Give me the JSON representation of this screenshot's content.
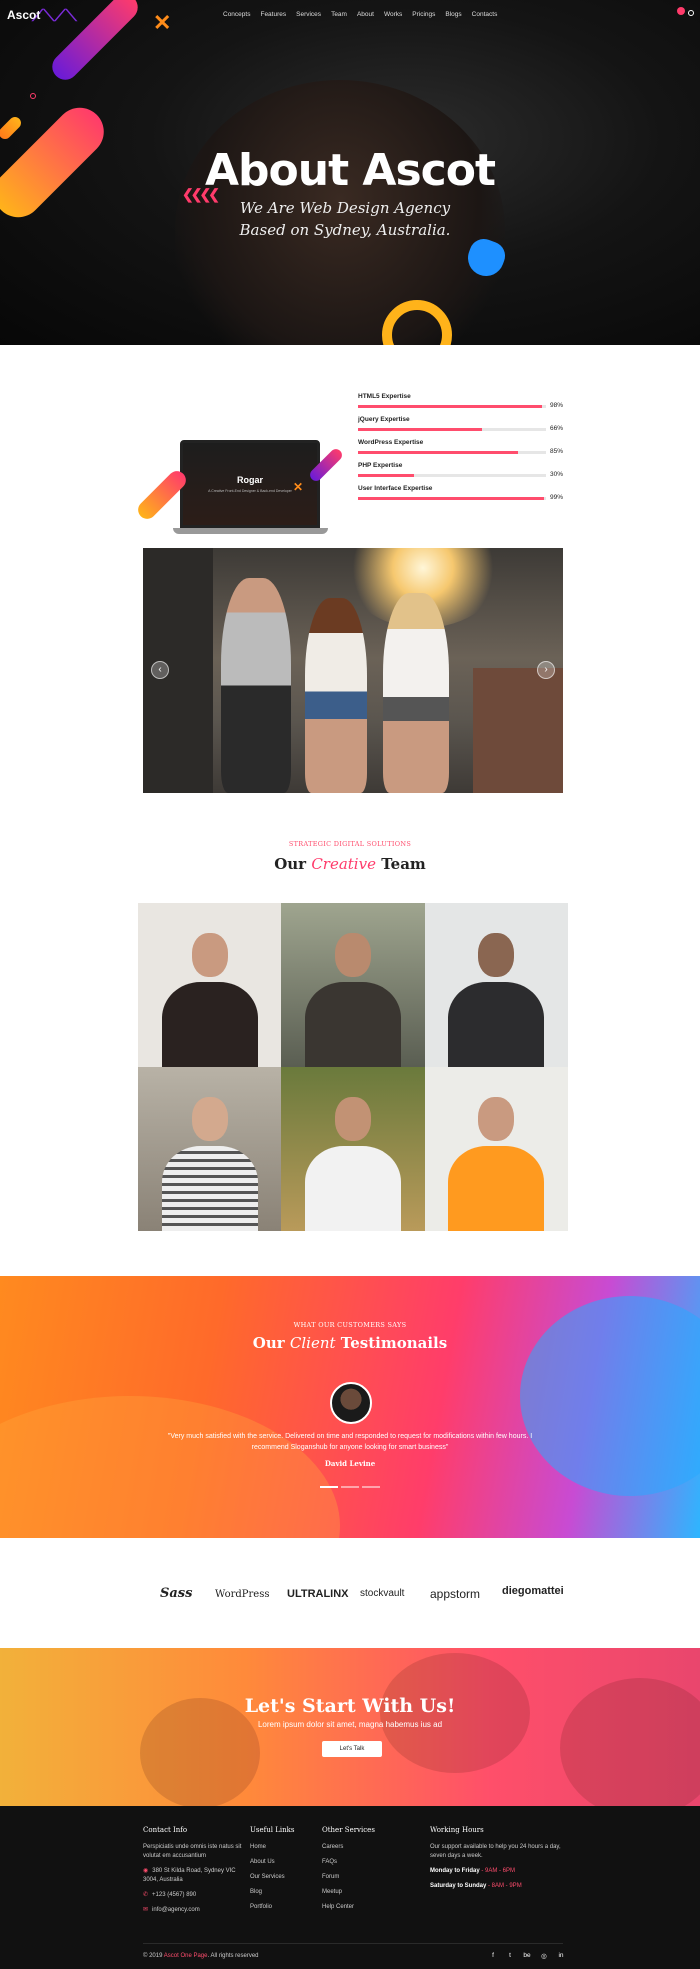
{
  "nav": {
    "logo": "Ascot",
    "items": [
      "Concepts",
      "Features",
      "Services",
      "Team",
      "About",
      "Works",
      "Pricings",
      "Blogs",
      "Contacts"
    ]
  },
  "hero": {
    "title": "About Ascot",
    "subtitle": "We Are Web Design Agency Based on Sydney, Australia."
  },
  "laptop": {
    "name": "Rogar",
    "blurb": "A Creative Front-End Designer & Back-end Developer"
  },
  "skills": [
    {
      "label": "HTML5 Expertise",
      "value": 98,
      "text": "98%"
    },
    {
      "label": "jQuery Expertise",
      "value": 66,
      "text": "66%"
    },
    {
      "label": "WordPress Expertise",
      "value": 85,
      "text": "85%"
    },
    {
      "label": "PHP Expertise",
      "value": 30,
      "text": "30%"
    },
    {
      "label": "User Interface Expertise",
      "value": 99,
      "text": "99%"
    }
  ],
  "slider": {
    "prev": "‹",
    "next": "›"
  },
  "team": {
    "kicker": "STRATEGIC DIGITAL SOLUTIONS",
    "title_pre": "Our",
    "title_em": "Creative",
    "title_post": "Team"
  },
  "testimonials": {
    "kicker": "WHAT OUR CUSTOMERS SAYS",
    "title_pre": "Our",
    "title_em": "Client",
    "title_post": "Testimonails",
    "quote": "\"Very much satisfied with the service. Delivered on time and responded to request for modifications within few hours. I recommend Sloganshub for anyone looking for smart business\"",
    "author": "David Levine"
  },
  "logos": [
    "Sass",
    "WordPress",
    "ULTRALINX",
    "stockvault",
    "appstorm",
    "diegomattei"
  ],
  "cta": {
    "title": "Let's Start With Us!",
    "subtitle": "Lorem ipsum dolor sit amet, magna habemus ius ad",
    "button": "Let's Talk"
  },
  "footer": {
    "contact": {
      "heading": "Contact Info",
      "text": "Perspiciatis unde omnis iste natus sit volutat em accusantium",
      "address": "380 St Kilda Road, Sydney VIC 3004, Australia",
      "phone": "+123 (4567) 890",
      "email": "info@agency.com"
    },
    "useful": {
      "heading": "Useful Links",
      "items": [
        "Home",
        "About Us",
        "Our Services",
        "Blog",
        "Portfolio"
      ]
    },
    "other": {
      "heading": "Other Services",
      "items": [
        "Careers",
        "FAQs",
        "Forum",
        "Meetup",
        "Help Center"
      ]
    },
    "hours": {
      "heading": "Working Hours",
      "text": "Our support available to help you 24 hours a day, seven days a week.",
      "weekday_label": "Monday to Friday",
      "weekday_time": "- 9AM - 6PM",
      "sat_label": "Saturday to Sunday",
      "sat_time": "- 8AM - 9PM"
    },
    "copyright_pre": "© 2019",
    "copyright_brand": "Ascot One Page",
    "copyright_post": ". All rights reserved",
    "social": [
      "f",
      "t",
      "be",
      "◎",
      "in"
    ]
  },
  "colors": {
    "accent": "#ff4d6d",
    "orange": "#ff8a1f",
    "footer_bg": "#111111"
  }
}
